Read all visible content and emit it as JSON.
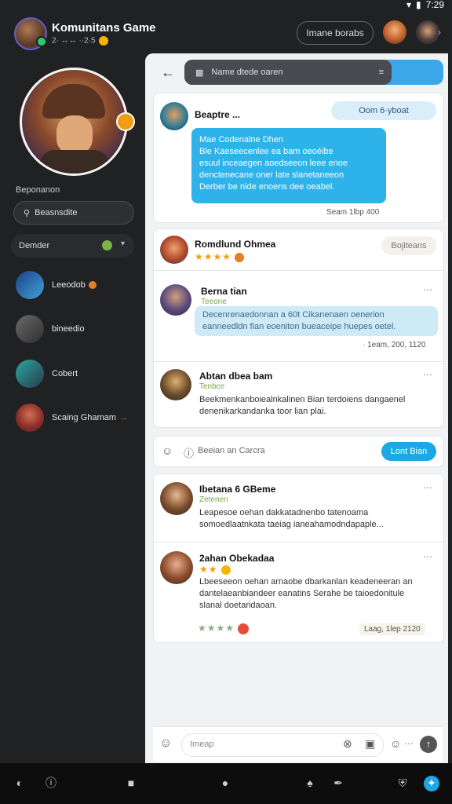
{
  "status": {
    "time": "7:29"
  },
  "header": {
    "title": "Komunitans Game",
    "subtitle": "2· ↔↔ ··2·5",
    "button_label": "Imane borabs"
  },
  "sidebar": {
    "section_label": "Beponanon",
    "search_label": "Beasnsdite",
    "select_value": "Demder",
    "items": [
      {
        "label": "Leeodob"
      },
      {
        "label": "bineedio"
      },
      {
        "label": "Cobert"
      },
      {
        "label": "Scaing Ghamam"
      }
    ]
  },
  "main": {
    "search_placeholder": "Name dtede oaren",
    "message": {
      "name": "Beaptre ...",
      "pill": "Oom 6·yboat",
      "bubble_lines": [
        "Mae Codenalne Dhen",
        "Ble Kaeseecenlee ea bam oeoéibe",
        "esuul inceaegen aoedseeon leee enoe",
        "denctenecane oner late slanetaneeon",
        "Derber be nide enoens dee oeabel."
      ],
      "time": "Seam 1lbp 400"
    },
    "post": {
      "name": "Romdlund Ohmea",
      "rating": "★★★★",
      "action": "Bojiteans",
      "reply": {
        "name": "Berna tian",
        "sub": "Teeone",
        "bubble_lines": [
          "Decenrenaedonnan a 60t Cikanenaen oenerion",
          "eanneedldn fian eoeniton bueaceipe huepes oetel."
        ],
        "time": "· 1eam, 200, 1120"
      },
      "reply2": {
        "name": "Abtan dbea bam",
        "sub": "Tenbce",
        "text_lines": [
          "Beekmenkanboiealnkalinen Bian terdoiens dangaenel",
          "denenikarkandanka toor lian plai."
        ]
      }
    },
    "composer": {
      "placeholder": "Beeian an Carcra",
      "button": "Lont Bian"
    },
    "thread": {
      "first": {
        "name": "Ibetana 6 GBeme",
        "sub": "Zetenen",
        "text_lines": [
          "Leapesoe oehan dakkatadnenbo tatenoama",
          "somoedlaatnkata taeiag ianeahamodndapaple..."
        ]
      },
      "second": {
        "name": "2ahan Obekadaa",
        "rating": "★★",
        "text_lines": [
          "Lbeeseeon oehan arnaobe dbarkanlan keadeneeran an",
          "dantelaeanbiandeer eanatins Serahe be taioedonitule",
          "slanal doetaridaoan."
        ],
        "rating2": "★★★★",
        "time": "Laag, 1lеp 2120"
      }
    },
    "input_placeholder": "Imeap"
  }
}
